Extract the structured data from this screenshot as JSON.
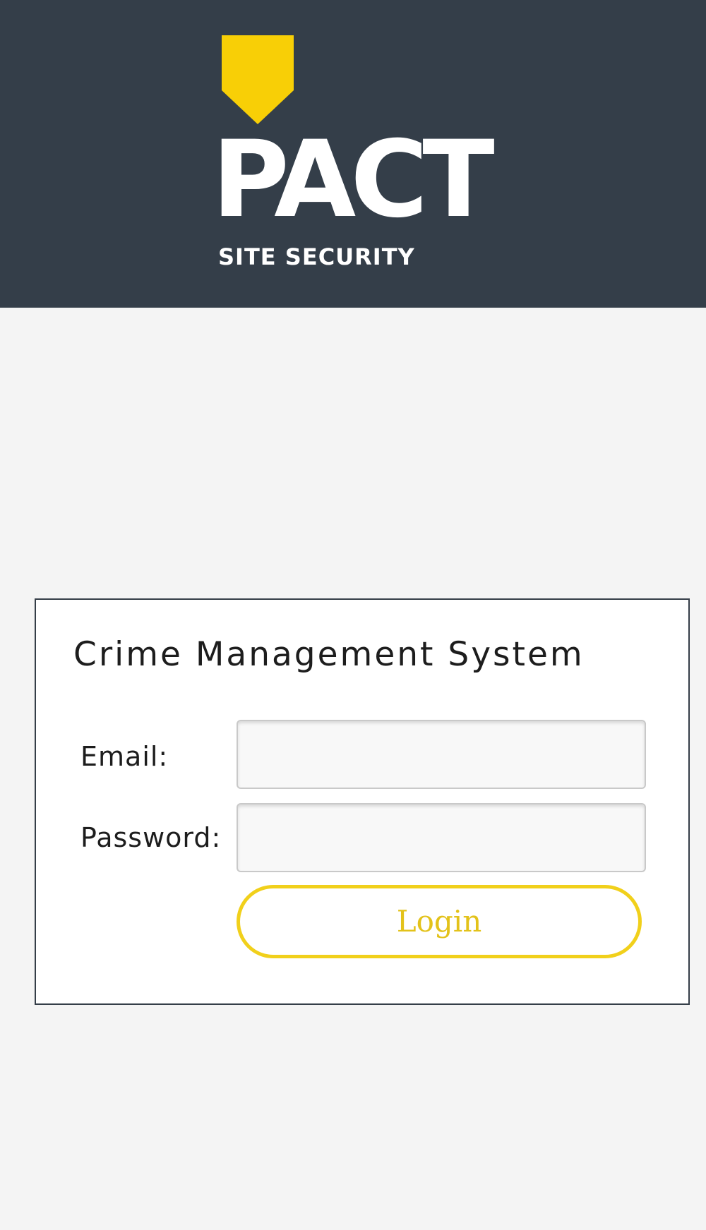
{
  "header": {
    "logo": {
      "word": "PACT",
      "tagline": "SITE SECURITY",
      "shield_icon": "shield-icon",
      "shield_color": "#f8cf06",
      "text_color": "#ffffff"
    },
    "background_color": "#343e49"
  },
  "login_form": {
    "title": "Crime Management System",
    "email_label": "Email:",
    "email_value": "",
    "password_label": "Password:",
    "password_value": "",
    "login_button_label": "Login",
    "button_color": "#f1d01b"
  },
  "page": {
    "background_color": "#f4f4f4"
  }
}
